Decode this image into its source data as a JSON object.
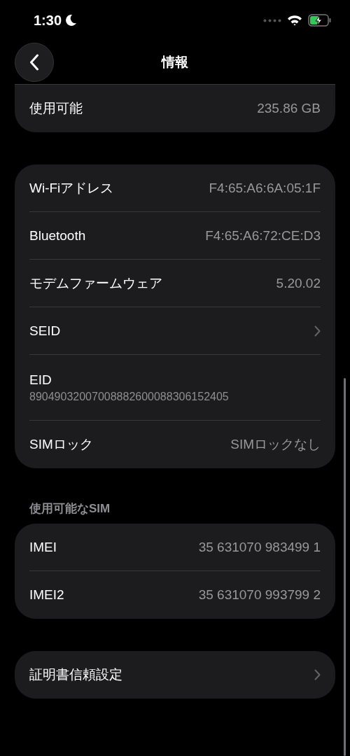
{
  "status_bar": {
    "time": "1:30"
  },
  "nav": {
    "title": "情報"
  },
  "groups": [
    {
      "cut_top": true,
      "rows": [
        {
          "kind": "value",
          "label": "使用可能",
          "value": "235.86 GB"
        }
      ]
    },
    {
      "cut_top": false,
      "rows": [
        {
          "kind": "value",
          "label": "Wi-Fiアドレス",
          "value": "F4:65:A6:6A:05:1F"
        },
        {
          "kind": "value",
          "label": "Bluetooth",
          "value": "F4:65:A6:72:CE:D3"
        },
        {
          "kind": "value",
          "label": "モデムファームウェア",
          "value": "5.20.02"
        },
        {
          "kind": "chevron",
          "label": "SEID"
        },
        {
          "kind": "stacked",
          "label": "EID",
          "value": "89049032007008882600088306152405"
        },
        {
          "kind": "value",
          "label": "SIMロック",
          "value": "SIMロックなし"
        }
      ]
    },
    {
      "header": "使用可能なSIM",
      "cut_top": false,
      "rows": [
        {
          "kind": "value",
          "label": "IMEI",
          "value": "35 631070 983499 1"
        },
        {
          "kind": "value",
          "label": "IMEI2",
          "value": "35 631070 993799 2"
        }
      ]
    },
    {
      "cut_top": false,
      "rows": [
        {
          "kind": "chevron",
          "label": "証明書信頼設定"
        }
      ]
    }
  ]
}
